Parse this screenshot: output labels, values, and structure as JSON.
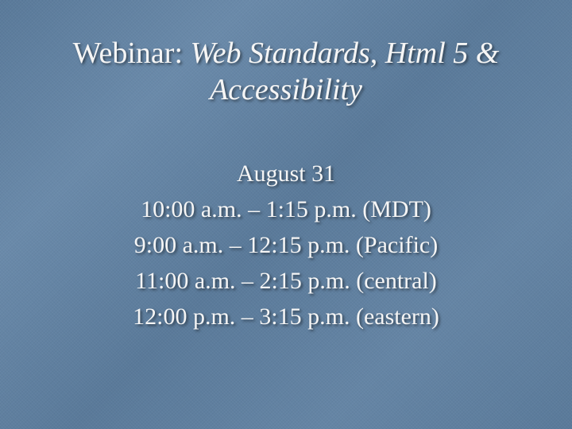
{
  "title": {
    "prefix": "Webinar: ",
    "main": "Web Standards, Html 5 & Accessibility"
  },
  "schedule": {
    "date": "August 31",
    "times": [
      "10:00 a.m. – 1:15 p.m. (MDT)",
      "9:00 a.m. – 12:15 p.m. (Pacific)",
      "11:00 a.m. – 2:15 p.m. (central)",
      "12:00 p.m. – 3:15 p.m. (eastern)"
    ]
  }
}
